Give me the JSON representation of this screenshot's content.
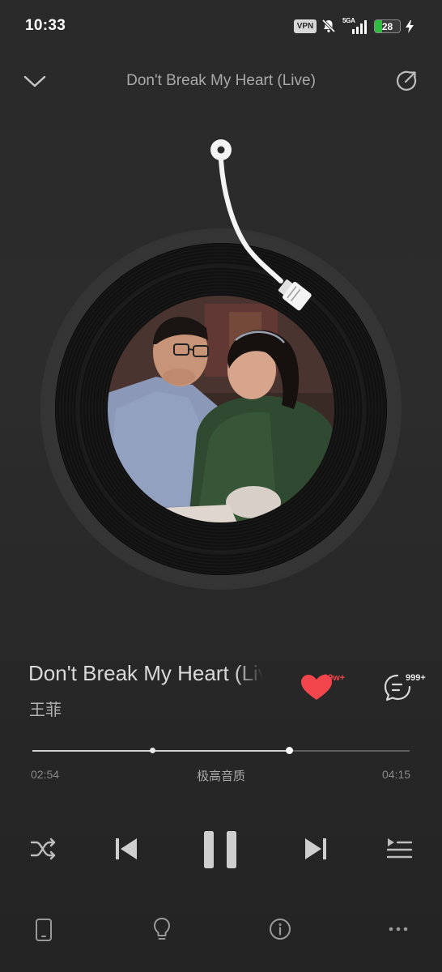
{
  "status_bar": {
    "time": "10:33",
    "vpn_label": "VPN",
    "network_label": "5GA",
    "battery_level": 28,
    "battery_text": "28",
    "icons": [
      "bell-off-icon",
      "signal-icon",
      "battery-icon",
      "charging-icon"
    ]
  },
  "header": {
    "title": "Don't Break My Heart (Live)",
    "collapse_icon": "chevron-down-icon",
    "share_icon": "share-icon"
  },
  "song": {
    "title": "Don't Break My Heart (Live)",
    "artist": "王菲",
    "like_count": "29w+",
    "comment_count": "999+",
    "liked": true
  },
  "playback": {
    "current_time": "02:54",
    "total_time": "04:15",
    "quality_label": "极高音质",
    "progress_fraction": 0.682,
    "buffer_fraction": 0.318,
    "state": "playing"
  },
  "controls": {
    "shuffle_icon": "shuffle-icon",
    "prev_icon": "skip-previous-icon",
    "pause_icon": "pause-icon",
    "next_icon": "skip-next-icon",
    "playlist_icon": "playlist-icon"
  },
  "bottom_bar": {
    "icons": [
      "device-icon",
      "lightbulb-icon",
      "info-icon",
      "more-icon"
    ]
  },
  "colors": {
    "background": "#2a2a2a",
    "accent_like": "#f2454c",
    "battery_fill": "#2fbd3f",
    "text_primary": "#d9d9d9",
    "text_secondary": "#a9a9a9"
  }
}
